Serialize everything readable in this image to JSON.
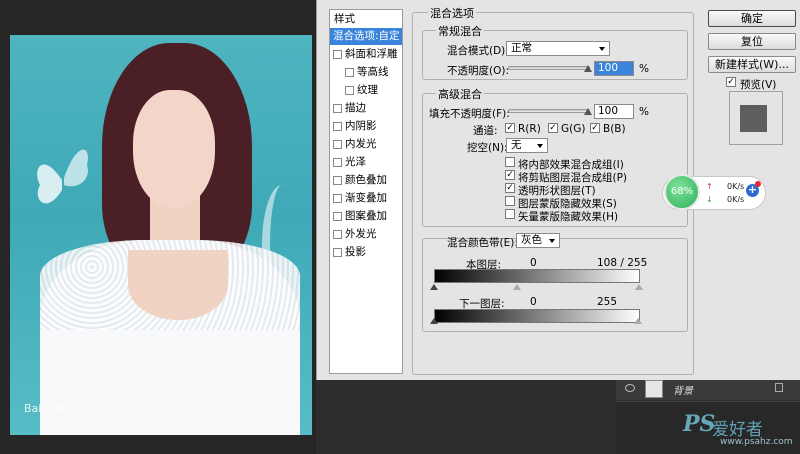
{
  "canvas": {
    "watermark": "Bai 百科"
  },
  "styles_panel": {
    "header": "样式",
    "items": [
      {
        "label": "混合选项:自定",
        "selected": true
      },
      {
        "label": "斜面和浮雕",
        "checked": false
      },
      {
        "label": "等高线",
        "checked": false,
        "sub": true
      },
      {
        "label": "纹理",
        "checked": false,
        "sub": true
      },
      {
        "label": "描边",
        "checked": false
      },
      {
        "label": "内阴影",
        "checked": false
      },
      {
        "label": "内发光",
        "checked": false
      },
      {
        "label": "光泽",
        "checked": false
      },
      {
        "label": "颜色叠加",
        "checked": false
      },
      {
        "label": "渐变叠加",
        "checked": false
      },
      {
        "label": "图案叠加",
        "checked": false
      },
      {
        "label": "外发光",
        "checked": false
      },
      {
        "label": "投影",
        "checked": false
      }
    ]
  },
  "blending": {
    "section_title": "混合选项",
    "general": {
      "title": "常规混合",
      "mode_label": "混合模式(D):",
      "mode_value": "正常",
      "opacity_label": "不透明度(O):",
      "opacity_value": "100",
      "opacity_unit": "%"
    },
    "advanced": {
      "title": "高级混合",
      "fill_label": "填充不透明度(F):",
      "fill_value": "100",
      "fill_unit": "%",
      "channels_label": "通道:",
      "channel_r": "R(R)",
      "channel_g": "G(G)",
      "channel_b": "B(B)",
      "knockout_label": "挖空(N):",
      "knockout_value": "无",
      "options": [
        {
          "label": "将内部效果混合成组(I)",
          "checked": false
        },
        {
          "label": "将剪贴图层混合成组(P)",
          "checked": true
        },
        {
          "label": "透明形状图层(T)",
          "checked": true
        },
        {
          "label": "图层蒙版隐藏效果(S)",
          "checked": false
        },
        {
          "label": "矢量蒙版隐藏效果(H)",
          "checked": false
        }
      ]
    },
    "blend_if": {
      "label": "混合颜色带(E):",
      "value": "灰色",
      "this_layer_label": "本图层:",
      "this_layer_low": "0",
      "this_layer_high": "108  /  255",
      "underlying_label": "下一图层:",
      "underlying_low": "0",
      "underlying_high": "255"
    }
  },
  "buttons": {
    "ok": "确定",
    "reset": "复位",
    "new_style": "新建样式(W)...",
    "preview": "预览(V)"
  },
  "network_widget": {
    "percent": "68%",
    "up_speed": "0K/s",
    "down_speed": "0K/s"
  },
  "layers_panel": {
    "layer_name": "背景"
  },
  "site_watermark": {
    "logo": "PS",
    "name": "爱好者",
    "url": "www.psahz.com"
  },
  "colors": {
    "selection": "#3b84dc",
    "dialog_bg": "#e4e4e4",
    "canvas_bg": "#4fb4c0"
  }
}
